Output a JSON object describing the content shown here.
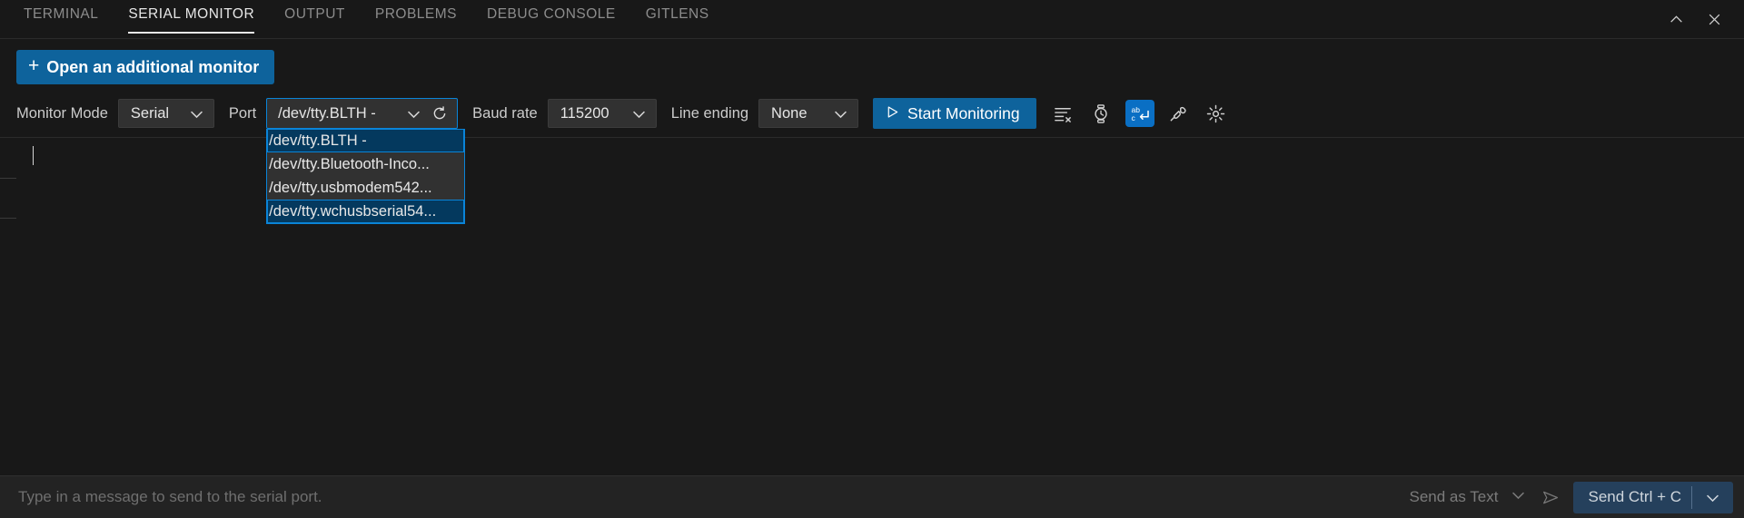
{
  "window": {
    "tabs": [
      {
        "label": "TERMINAL",
        "active": false
      },
      {
        "label": "SERIAL MONITOR",
        "active": true
      },
      {
        "label": "OUTPUT",
        "active": false
      },
      {
        "label": "PROBLEMS",
        "active": false
      },
      {
        "label": "DEBUG CONSOLE",
        "active": false
      },
      {
        "label": "GITLENS",
        "active": false
      }
    ],
    "actions": [
      {
        "name": "chevron-up-icon",
        "title": "Maximize Panel Size"
      },
      {
        "name": "close-icon",
        "title": "Close Panel"
      }
    ]
  },
  "add_monitor": {
    "plus": "+",
    "label": "Open an additional monitor"
  },
  "toolbar": {
    "monitor_mode_label": "Monitor Mode",
    "monitor_mode_value": "Serial",
    "port_label": "Port",
    "port_value": "/dev/tty.BLTH -",
    "refresh_icon": "refresh-icon",
    "baud_label": "Baud rate",
    "baud_value": "115200",
    "line_ending_label": "Line ending",
    "line_ending_value": "None",
    "start_button_label": "Start Monitoring",
    "icons": [
      {
        "name": "clear-output-icon",
        "active": false
      },
      {
        "name": "toggle-timestamp-icon",
        "active": false
      },
      {
        "name": "toggle-line-ending-icon",
        "active": true
      },
      {
        "name": "port-connection-icon",
        "active": false
      },
      {
        "name": "settings-gear-icon",
        "active": false
      }
    ]
  },
  "port_dropdown": {
    "open": true,
    "items": [
      {
        "label": "/dev/tty.BLTH -",
        "selected": true
      },
      {
        "label": "/dev/tty.Bluetooth-Inco...",
        "selected": false
      },
      {
        "label": "/dev/tty.usbmodem542...",
        "selected": false
      },
      {
        "label": "/dev/tty.wchusbserial54...",
        "selected": true
      }
    ]
  },
  "send_bar": {
    "input_value": "",
    "input_placeholder": "Type in a message to send to the serial port.",
    "send_as_label": "Send as Text",
    "send_icon": "send-icon",
    "send_ctrl_label": "Send Ctrl + C"
  },
  "colors": {
    "accent": "#0e639c",
    "focus_ring": "#0a84d8",
    "selection": "#04395e",
    "panel_bg": "#181818",
    "control_bg": "#313131"
  }
}
